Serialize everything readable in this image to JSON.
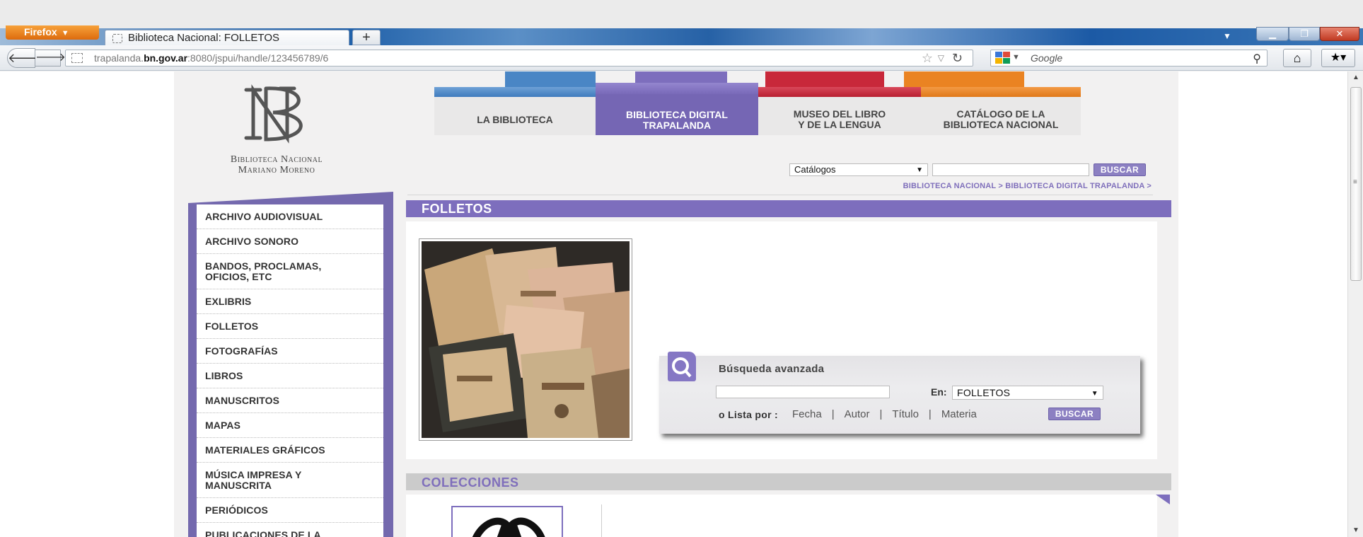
{
  "browser": {
    "menu_button": "Firefox",
    "tab_title": "Biblioteca Nacional: FOLLETOS",
    "new_tab": "+",
    "url_prefix": "trapalanda.",
    "url_domain": "bn.gov.ar",
    "url_suffix": ":8080/jspui/handle/123456789/6",
    "search_placeholder": "Google"
  },
  "site": {
    "logo_line1": "Biblioteca Nacional",
    "logo_line2": "Mariano Moreno"
  },
  "top_nav": [
    {
      "line1": "LA BIBLIOTECA",
      "line2": "",
      "color": "#4a86c5"
    },
    {
      "line1": "BIBLIOTECA DIGITAL",
      "line2": "TRAPALANDA",
      "color": "#7d6ebd"
    },
    {
      "line1": "MUSEO DEL LIBRO",
      "line2": "Y DE LA LENGUA",
      "color": "#c8283a"
    },
    {
      "line1": "CATÁLOGO DE LA",
      "line2": "BIBLIOTECA NACIONAL",
      "color": "#ea8322"
    }
  ],
  "catalog_search": {
    "selected": "Catálogos",
    "button": "BUSCAR"
  },
  "breadcrumb": "BIBLIOTECA NACIONAL  > BIBLIOTECA DIGITAL TRAPALANDA >",
  "sidebar": [
    {
      "line1": "ARCHIVO AUDIOVISUAL",
      "line2": ""
    },
    {
      "line1": "ARCHIVO SONORO",
      "line2": ""
    },
    {
      "line1": "BANDOS, PROCLAMAS,",
      "line2": "OFICIOS, ETC"
    },
    {
      "line1": "EXLIBRIS",
      "line2": ""
    },
    {
      "line1": "FOLLETOS",
      "line2": ""
    },
    {
      "line1": "FOTOGRAFÍAS",
      "line2": ""
    },
    {
      "line1": "LIBROS",
      "line2": ""
    },
    {
      "line1": "MANUSCRITOS",
      "line2": ""
    },
    {
      "line1": "MAPAS",
      "line2": ""
    },
    {
      "line1": "MATERIALES GRÁFICOS",
      "line2": ""
    },
    {
      "line1": "MÚSICA IMPRESA Y",
      "line2": "MANUSCRITA"
    },
    {
      "line1": "PERIÓDICOS",
      "line2": ""
    },
    {
      "line1": "PUBLICACIONES DE LA",
      "line2": ""
    }
  ],
  "folletos": {
    "header": "FOLLETOS"
  },
  "advanced_search": {
    "title": "Búsqueda avanzada",
    "en_label": "En:",
    "selected": "FOLLETOS",
    "list_label": "o Lista por :",
    "links": [
      "Fecha",
      "Autor",
      "Título",
      "Materia"
    ],
    "button": "BUSCAR"
  },
  "colecciones": {
    "header": "COLECCIONES"
  },
  "colors": {
    "purple": "#7d6ebd",
    "blue": "#4a86c5",
    "red": "#c8283a",
    "orange": "#ea8322"
  }
}
